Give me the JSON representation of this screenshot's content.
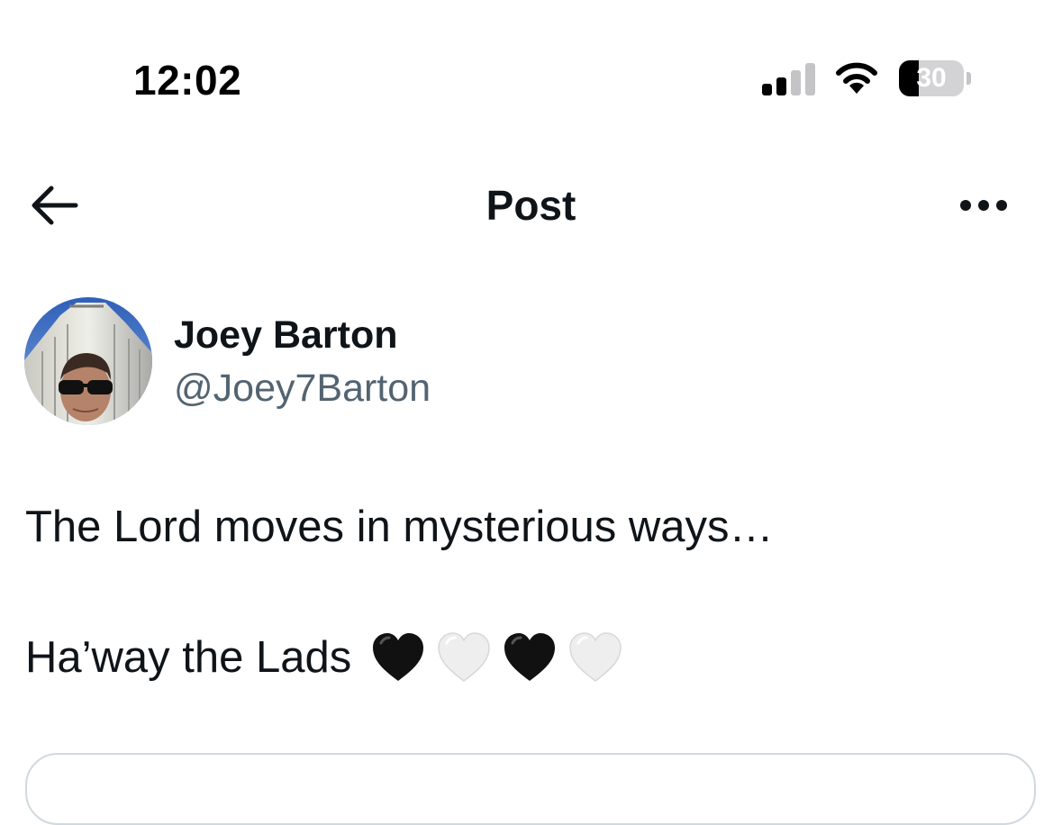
{
  "status_bar": {
    "time": "12:02",
    "signal_icon": "cellular-signal-icon",
    "signal_bars_active": 2,
    "signal_bars_total": 4,
    "wifi_icon": "wifi-icon",
    "battery_icon": "battery-icon",
    "battery_level": "30",
    "battery_fraction": 0.3
  },
  "header": {
    "back_icon": "arrow-left-icon",
    "title": "Post",
    "more_icon": "ellipsis-icon"
  },
  "author": {
    "name": "Joey Barton",
    "handle": "@Joey7Barton"
  },
  "post": {
    "text_line1": "The Lord moves in mysterious ways…",
    "text_line2": "Ha’way the Lads",
    "emojis": [
      "black-heart",
      "white-heart",
      "black-heart",
      "white-heart"
    ]
  },
  "colors": {
    "text_primary": "#0f1419",
    "text_secondary": "#536471",
    "divider": "#cfd9de",
    "background": "#ffffff"
  }
}
